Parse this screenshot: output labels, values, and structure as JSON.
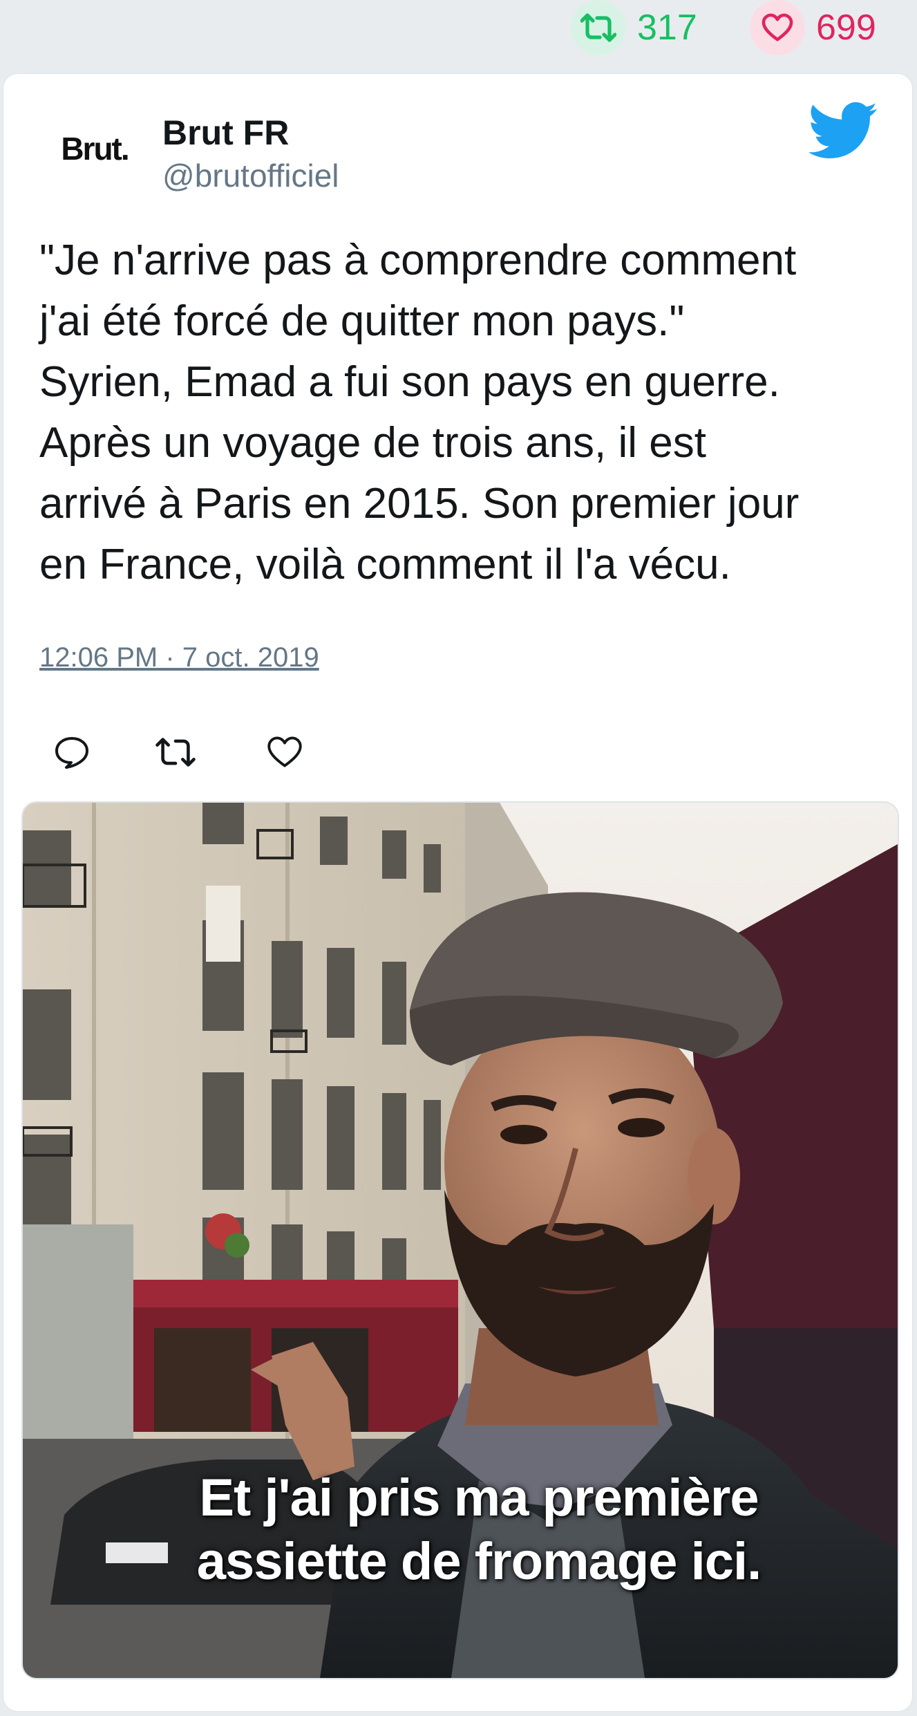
{
  "stats": {
    "retweets": "317",
    "likes": "699"
  },
  "tweet": {
    "display_name": "Brut FR",
    "handle": "@brutofficiel",
    "avatar_text": "Brut.",
    "text": "\"Je n'arrive pas à comprendre comment\nj'ai été forcé de quitter mon pays.\"\nSyrien, Emad a fui son pays en guerre.\nAprès un voyage de trois ans, il est\narrivé à Paris en 2015. Son premier jour\nen France, voilà comment il l'a vécu.",
    "timestamp": "12:06 PM · 7 oct. 2019"
  },
  "media": {
    "subtitle_line1": "Et j'ai pris ma première",
    "subtitle_line2": "assiette de fromage ici."
  },
  "icons": {
    "retweet": "retweet-icon",
    "like": "heart-icon",
    "reply": "reply-icon",
    "brand": "twitter-bird-icon"
  },
  "colors": {
    "retweet": "#17bf63",
    "like": "#e0245e",
    "twitter_blue": "#1da1f2",
    "muted": "#657786"
  }
}
